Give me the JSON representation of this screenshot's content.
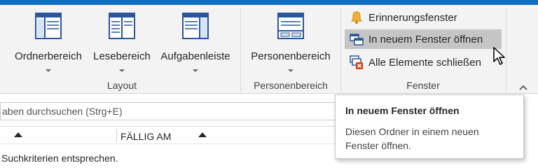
{
  "ribbon": {
    "layout_group": {
      "label": "Layout",
      "buttons": [
        {
          "label": "Ordnerbereich"
        },
        {
          "label": "Lesebereich"
        },
        {
          "label": "Aufgabenleiste"
        }
      ]
    },
    "personen_group": {
      "label": "Personenbereich",
      "button": {
        "label": "Personenbereich"
      }
    },
    "fenster_group": {
      "label": "Fenster",
      "items": [
        {
          "label": "Erinnerungsfenster",
          "icon": "bell-icon"
        },
        {
          "label": "In neuem Fenster öffnen",
          "icon": "new-window-icon"
        },
        {
          "label": "Alle Elemente schließen",
          "icon": "close-all-icon"
        }
      ]
    }
  },
  "search": {
    "text": "aben durchsuchen (Strg+E)"
  },
  "columns": {
    "due_label": "FÄLLIG AM"
  },
  "list": {
    "empty_message": "Suchkriterien entsprechen."
  },
  "tooltip": {
    "title": "In neuem Fenster öffnen",
    "description": "Diesen Ordner in einem neuen Fenster öffnen."
  },
  "colors": {
    "accent": "#106ebe",
    "ribbon_bg": "#f3f3f3",
    "hover": "#c5c5c5",
    "icon_blue": "#2b579a"
  }
}
